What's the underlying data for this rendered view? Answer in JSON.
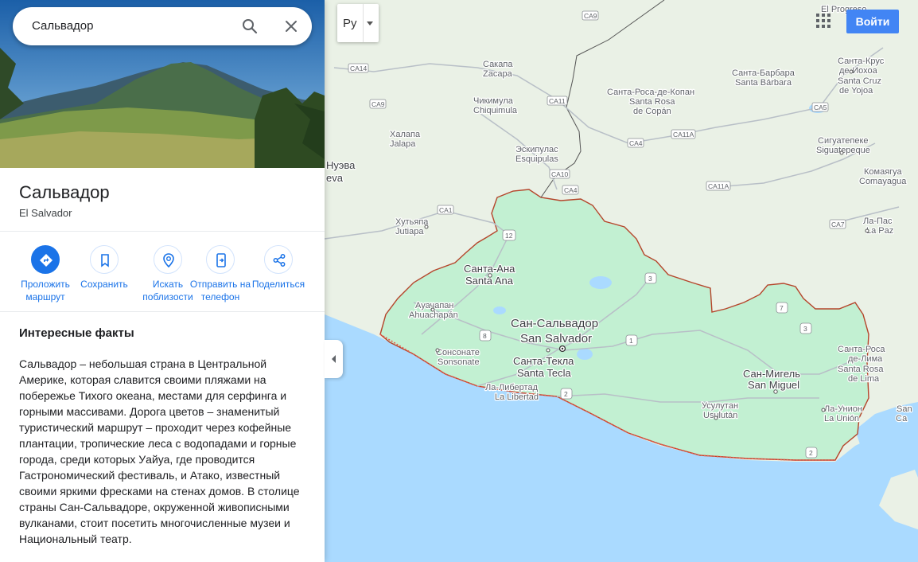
{
  "search": {
    "value": "Сальвадор"
  },
  "place": {
    "title": "Сальвадор",
    "subtitle": "El Salvador"
  },
  "actions": [
    {
      "label": "Проложить маршрут"
    },
    {
      "label": "Сохранить"
    },
    {
      "label": "Искать поблизости"
    },
    {
      "label": "Отправить на телефон"
    },
    {
      "label": "Поделиться"
    }
  ],
  "facts": {
    "title": "Интересные факты",
    "text": "Сальвадор – небольшая страна в Центральной Америке, которая славится своими пляжами на побережье Тихого океана, местами для серфинга и горными массивами. Дорога цветов – знаменитый туристический маршрут – проходит через кофейные плантации, тропические леса с водопадами и горные города, среди которых Уайуа, где проводится Гастрономический фестиваль, и Атако, известный своими яркими фресками на стенах домов. В столице страны Сан-Сальвадоре, окруженной живописными вулканами, стоит посетить многочисленные музеи и Национальный театр."
  },
  "map": {
    "layer_label": "Ру",
    "signin_label": "Войти",
    "colors": {
      "water": "#aadaff",
      "land": "#eaf1e6",
      "highlight": "#c2f0d2",
      "border": "#b5452b",
      "road": "#b8bfc7"
    },
    "labels": {
      "el_progreso": "El Progreso",
      "sakapa_ru": "Сакапа",
      "sakapa_es": "Zacapa",
      "chikimula_ru": "Чикимула",
      "chikimula_es": "Chiquimula",
      "khalapa_ru": "Халапа",
      "khalapa_es": "Jalapa",
      "eskipulas_ru": "Эскипулас",
      "eskipulas_es": "Esquipulas",
      "khutiapa_ru": "Хутьяпа",
      "khutiapa_es": "Jutiapa",
      "nueva_a": "Нуэва",
      "nueva_b": "eva",
      "santa_rosa_kopan_ru": "Санта-Роса-де-Копан",
      "santa_rosa_kopan_es1": "Santa Rosa",
      "santa_rosa_kopan_es2": "de Copán",
      "santa_barbara_ru": "Санта-Барбара",
      "santa_barbara_es": "Santa Bárbara",
      "santa_krus_ru1": "Санта-Крус",
      "santa_krus_ru2": "де-Иохоа",
      "santa_krus_es1": "Santa Cruz",
      "santa_krus_es2": "de Yojoa",
      "siguatepeke_ru": "Сигуатепеке",
      "siguatepeke_es": "Siguatepeque",
      "komayagua_ru": "Комаягуа",
      "komayagua_es": "Comayagua",
      "la_pas_ru": "Ла-Пас",
      "la_pas_es": "La Paz",
      "santa_ana_ru": "Санта-Ана",
      "santa_ana_es": "Santa Ana",
      "ahuachapan_ru": "Ауачапан",
      "ahuachapan_es": "Ahuachapán",
      "sonsonate_ru": "Сонсонате",
      "sonsonate_es": "Sonsonate",
      "san_salvador_ru": "Сан-Сальвадор",
      "san_salvador_es": "San Salvador",
      "santa_tekla_ru": "Санта-Текла",
      "santa_tekla_es": "Santa Tecla",
      "la_libertad_ru": "Ла-Либертад",
      "la_libertad_es": "La Libertad",
      "san_migel_ru": "Сан-Мигель",
      "san_migel_es": "San Miguel",
      "usulutan_ru": "Усулутан",
      "usulutan_es": "Usulután",
      "santa_rosa_lima_ru1": "Санта-Роса",
      "santa_rosa_lima_ru2": "де-Лима",
      "santa_rosa_lima_es1": "Santa Rosa",
      "santa_rosa_lima_es2": "de Lima",
      "la_union_ru": "Ла-Унион",
      "la_union_es": "La Unión",
      "san_a": "San",
      "san_b": "Са"
    },
    "shields": {
      "ca9_top": "CA9",
      "ca14": "CA14",
      "ca9_left": "CA9",
      "ca11": "CA11",
      "ca4_a": "CA4",
      "ca11a_a": "CA11A",
      "ca10": "CA10",
      "ca4_b": "CA4",
      "ca1": "CA1",
      "ca11a_b": "CA11A",
      "ca5": "CA5",
      "ca7": "CA7",
      "r12": "12",
      "r3a": "3",
      "r7": "7",
      "r3b": "3",
      "r8": "8",
      "r1": "1",
      "r2a": "2",
      "r2b": "2"
    }
  }
}
